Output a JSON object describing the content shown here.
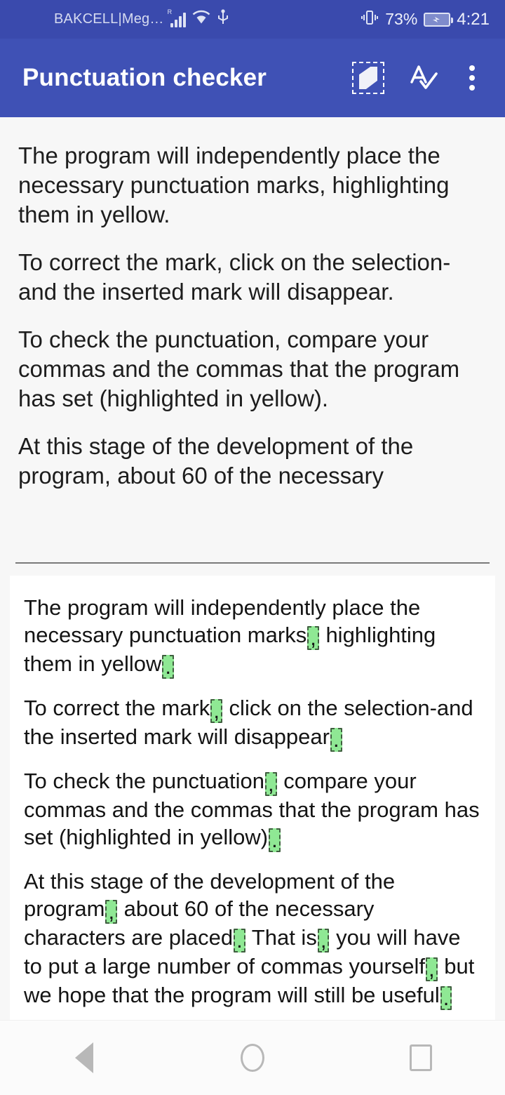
{
  "status_bar": {
    "carrier": "BAKCELL|Meg…",
    "roaming_indicator": "R",
    "battery_percent": "73%",
    "clock": "4:21",
    "icons": [
      "signal-bars-icon",
      "wifi-icon",
      "usb-icon",
      "vibrate-icon",
      "battery-charging-icon"
    ],
    "background_color": "#3a4aad"
  },
  "app_bar": {
    "title": "Punctuation checker",
    "background_color": "#3f51b5",
    "actions": [
      {
        "name": "paste-icon",
        "label": "Paste"
      },
      {
        "name": "spellcheck-icon",
        "label": "Check"
      },
      {
        "name": "overflow-menu-icon",
        "label": "More options"
      }
    ]
  },
  "input_area": {
    "paragraphs": [
      "The program will independently place the necessary punctuation marks, highlighting them in yellow.",
      "To correct the mark, click on the selection-and the inserted mark will disappear.",
      "To check the punctuation, compare your commas and the commas that the program has set (highlighted in yellow).",
      "At this stage of the development of the program, about 60 of the necessary"
    ]
  },
  "result_card": {
    "highlight_color": "#8fe894",
    "paragraphs": [
      [
        {
          "t": "The program will independently place the necessary punctuation marks"
        },
        {
          "t": ",",
          "mark": true
        },
        {
          "t": " highlighting them in yellow"
        },
        {
          "t": ".",
          "mark": true
        }
      ],
      [
        {
          "t": "To correct the mark"
        },
        {
          "t": ",",
          "mark": true
        },
        {
          "t": " click on the selection-and the inserted mark will disappear"
        },
        {
          "t": ".",
          "mark": true
        }
      ],
      [
        {
          "t": "To check the punctuation"
        },
        {
          "t": ",",
          "mark": true
        },
        {
          "t": " compare your commas and the commas that the program has set (highlighted in yellow)"
        },
        {
          "t": ".",
          "mark": true
        }
      ],
      [
        {
          "t": "At this stage of the development of the program"
        },
        {
          "t": ",",
          "mark": true
        },
        {
          "t": " about 60 of the necessary characters are placed"
        },
        {
          "t": ".",
          "mark": true
        },
        {
          "t": " That is"
        },
        {
          "t": ",",
          "mark": true
        },
        {
          "t": " you will have to put a large number of commas yourself"
        },
        {
          "t": ",",
          "mark": true
        },
        {
          "t": " but we hope that the program will still be useful"
        },
        {
          "t": ".",
          "mark": true
        }
      ]
    ]
  },
  "nav_bar": {
    "buttons": [
      {
        "name": "nav-back-button",
        "label": "Back"
      },
      {
        "name": "nav-home-button",
        "label": "Home"
      },
      {
        "name": "nav-recents-button",
        "label": "Recents"
      }
    ]
  }
}
